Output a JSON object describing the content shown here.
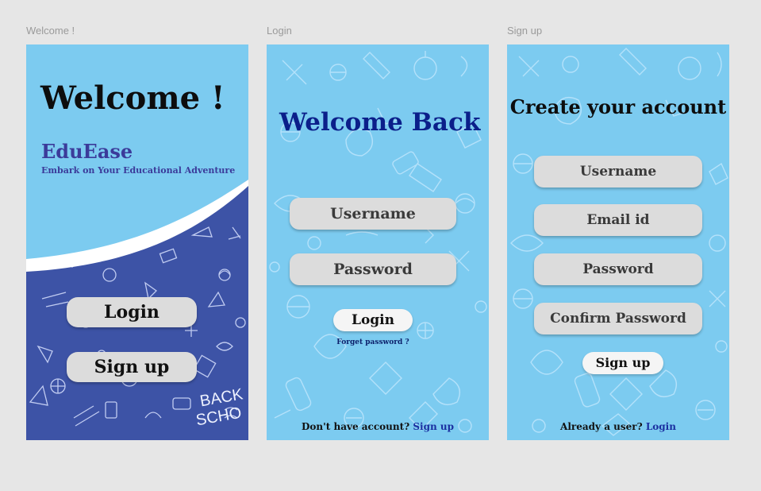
{
  "frames": {
    "welcome": {
      "label": "Welcome !",
      "heading": "Welcome !",
      "brand": "EduEase",
      "tagline": "Embark on Your Educational Adventure",
      "login_button": "Login",
      "signup_button": "Sign up"
    },
    "login": {
      "label": "Login",
      "heading": "Welcome Back !",
      "username_placeholder": "Username",
      "password_placeholder": "Password",
      "login_button": "Login",
      "forgot_link": "Forget password ?",
      "footer_text": "Don't have account?",
      "footer_link": "Sign up"
    },
    "signup": {
      "label": "Sign up",
      "heading": "Create your account",
      "username_placeholder": "Username",
      "email_placeholder": "Email id",
      "password_placeholder": "Password",
      "confirm_placeholder": "Confirm Password",
      "signup_button": "Sign up",
      "footer_text": "Already a user?",
      "footer_link": "Login"
    }
  },
  "colors": {
    "canvas": "#e6e6e6",
    "sky_blue": "#7ccbf0",
    "navy_pattern": "#3d53a6",
    "brand_purple": "#3b3b9a",
    "heading_navy": "#0b1f8a",
    "link_blue": "#1a2fa0"
  },
  "icons": [
    "science-doodle-pattern",
    "school-doodle-pattern"
  ]
}
